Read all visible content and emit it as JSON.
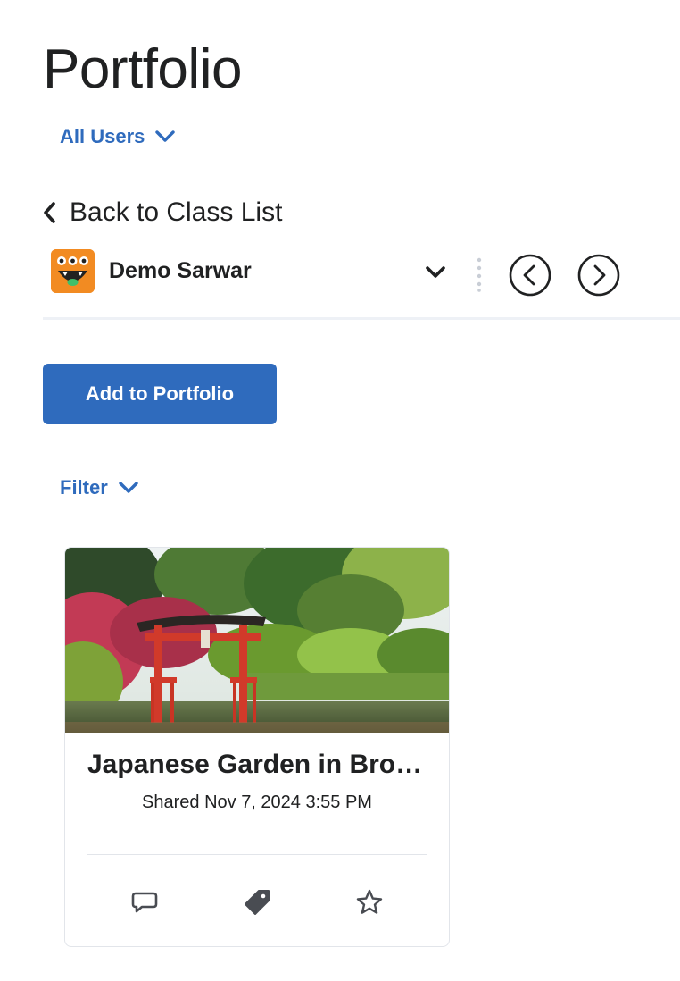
{
  "page": {
    "title": "Portfolio"
  },
  "users_filter": {
    "label": "All Users",
    "icon": "chevron-down-icon"
  },
  "back": {
    "label": "Back to Class List",
    "icon": "chevron-left-icon"
  },
  "user": {
    "name": "Demo Sarwar",
    "avatar_icon": "monster-avatar"
  },
  "actions": {
    "add_label": "Add to Portfolio",
    "filter_label": "Filter"
  },
  "card": {
    "title": "Japanese Garden in Brooklyn",
    "shared_date": "Shared Nov 7, 2024 3:55 PM",
    "actions": [
      "comment-icon",
      "tag-icon",
      "star-icon"
    ]
  },
  "colors": {
    "accent": "#2f6bbd",
    "avatar": "#f28b22",
    "text": "#202122"
  }
}
